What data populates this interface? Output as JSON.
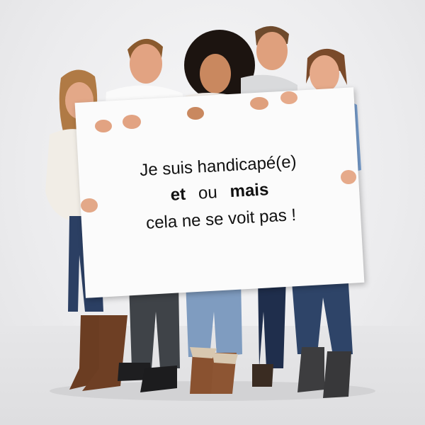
{
  "sign": {
    "line1": "Je suis handicapé(e)",
    "line2": {
      "bold1": "et",
      "middle": "ou",
      "bold2": "mais"
    },
    "line3": "cela ne se voit pas !"
  },
  "colors": {
    "background": "#ececee",
    "sign": "#fbfbfb",
    "text": "#111111",
    "skin": "#e0a383",
    "jeans": "#2e4468",
    "light_jeans": "#7f9cc0",
    "boots_brown": "#6b3d22",
    "boots_grey": "#3d3d3f"
  }
}
